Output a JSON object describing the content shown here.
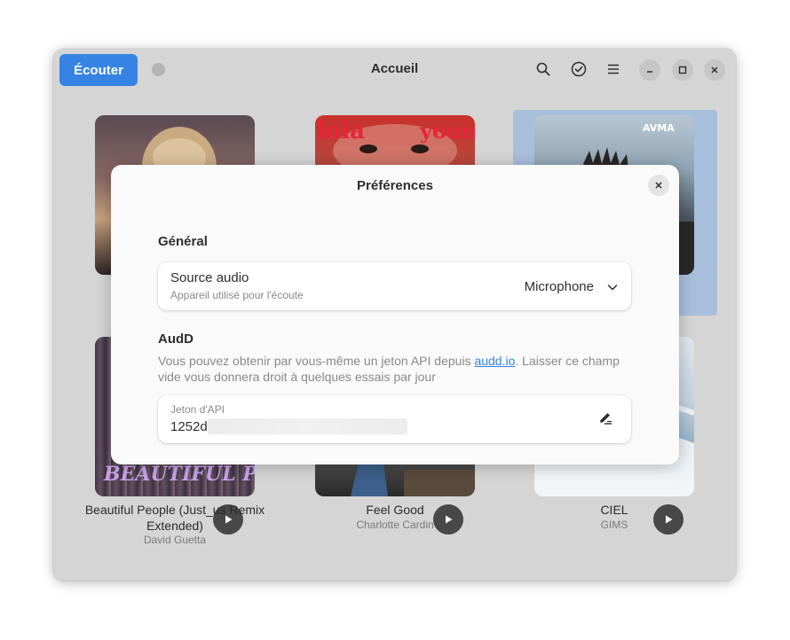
{
  "window": {
    "title": "Accueil",
    "listen_label": "Écouter",
    "icons": [
      "search-icon",
      "check-circle-icon",
      "menu-icon",
      "minimize-icon",
      "maximize-icon",
      "close-icon"
    ]
  },
  "songs": [
    {
      "title": "Beautiful People (Just_us Remix Extended)",
      "artist": "David Guetta",
      "art_text": "BEAUTIFUL PEOPLE"
    },
    {
      "title": "Feel Good",
      "artist": "Charlotte Cardin",
      "art_text": ""
    },
    {
      "title": "CIEL",
      "artist": "GIMS",
      "art_text": ""
    }
  ],
  "top_row_art": [
    {
      "art_text": ""
    },
    {
      "art_text_left": "lola",
      "art_text_right": "young"
    },
    {
      "art_text": "AVMA"
    }
  ],
  "preferences": {
    "title": "Préférences",
    "general": {
      "section_title": "Général",
      "audio_source": {
        "title": "Source audio",
        "subtitle": "Appareil utilisé pour l'écoute",
        "value": "Microphone"
      }
    },
    "audd": {
      "section_title": "AudD",
      "desc_before": "Vous pouvez obtenir par vous-même un jeton API depuis ",
      "desc_link": "audd.io",
      "desc_after": ". Laisser ce champ vide vous donnera droit à quelques essais par jour",
      "api_label": "Jeton d'API",
      "api_value": "1252d"
    }
  },
  "colors": {
    "accent": "#3584e4",
    "selection": "#a8bfdc"
  }
}
